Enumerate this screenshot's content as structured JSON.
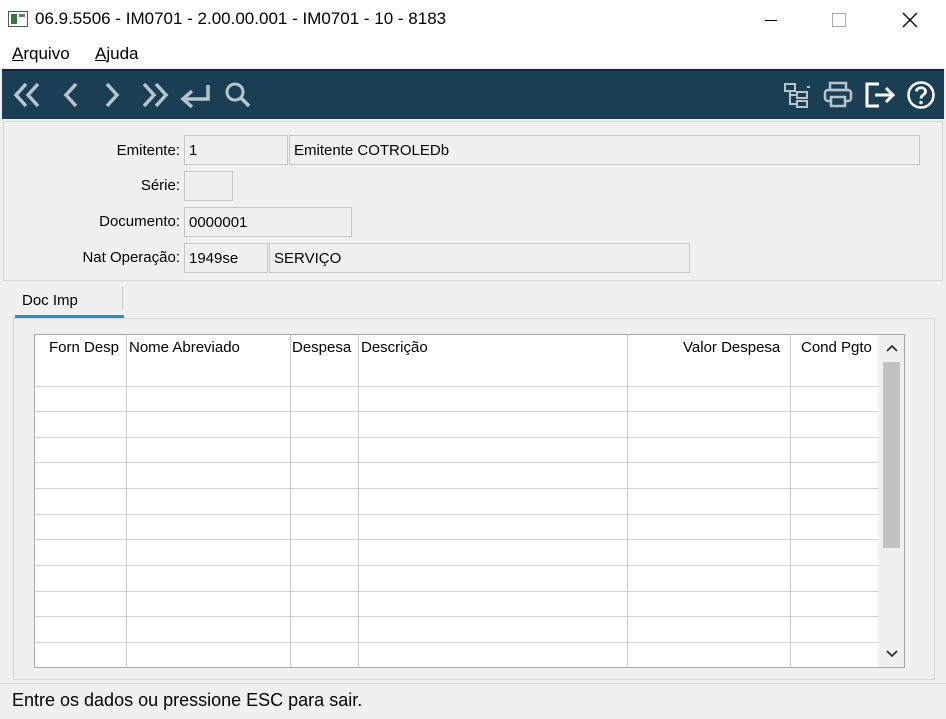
{
  "window": {
    "title": "06.9.5506 - IM0701 - 2.00.00.001 - IM0701 - 10 - 8183",
    "minimize_label": "—",
    "close_label": "✕"
  },
  "menu": {
    "arquivo": {
      "first": "A",
      "rest": "rquivo"
    },
    "ajuda": {
      "first": "A",
      "rest": "juda"
    }
  },
  "toolbar": {
    "background": "#1a3f54",
    "icons": [
      "first-icon",
      "prev-icon",
      "next-icon",
      "last-icon",
      "return-icon",
      "search-icon",
      "tree-icon",
      "print-icon",
      "exit-icon",
      "help-icon"
    ]
  },
  "form": {
    "emitente_label": "Emitente:",
    "emitente_code": "1",
    "emitente_name": "Emitente COTROLEDb",
    "serie_label": "Série:",
    "serie_value": "",
    "documento_label": "Documento:",
    "documento_value": "0000001",
    "natop_label": "Nat Operação:",
    "natop_code": "1949se",
    "natop_desc": "SERVIÇO"
  },
  "tabs": [
    {
      "label": "Doc Imp",
      "active": true
    }
  ],
  "grid": {
    "columns": [
      "Forn Desp",
      "Nome Abreviado",
      "Despesa",
      "Descrição",
      "Valor Despesa",
      "Cond Pgto"
    ],
    "rows": []
  },
  "status": {
    "text": "Entre os dados ou pressione ESC para sair."
  }
}
